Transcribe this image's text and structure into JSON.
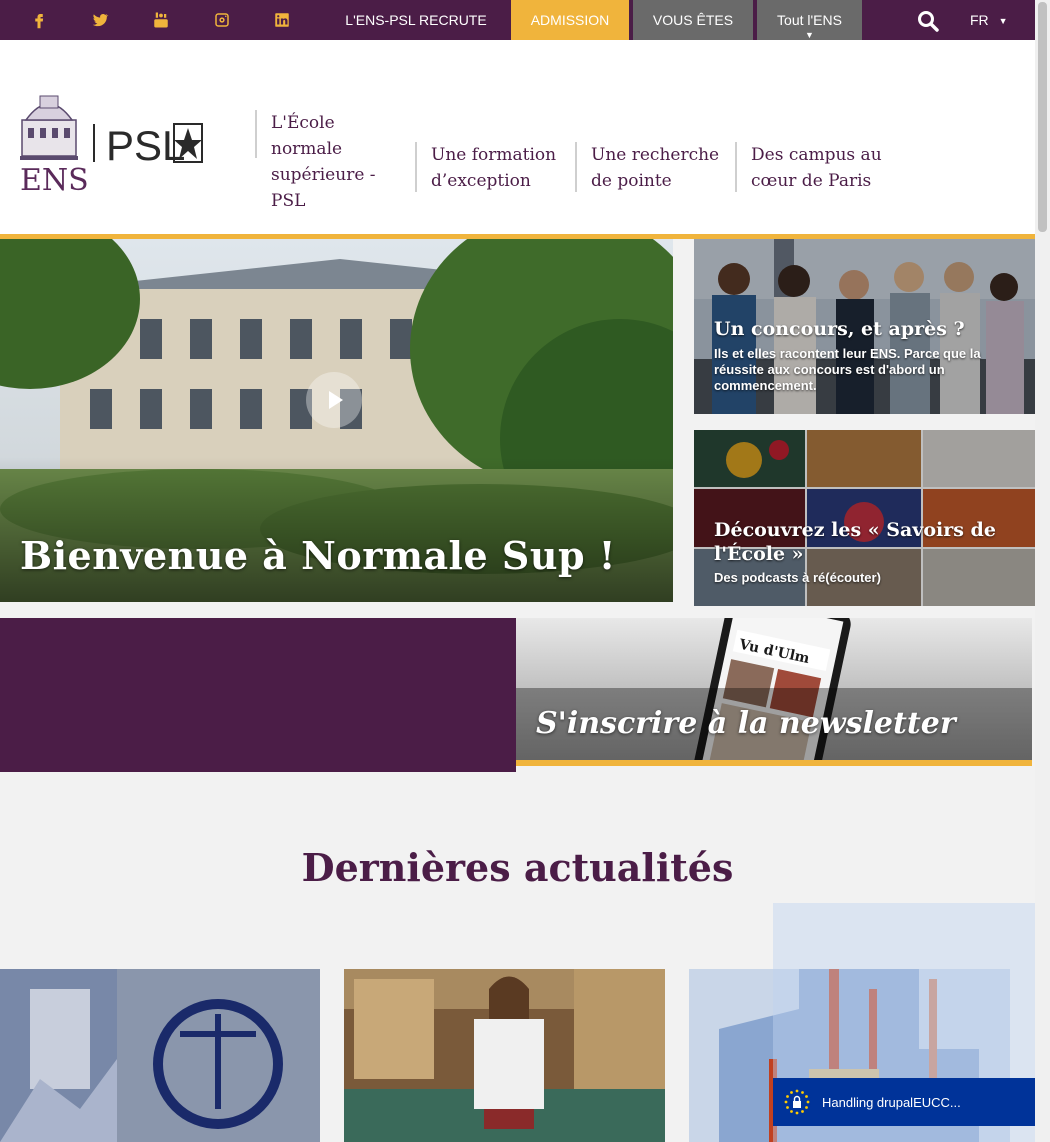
{
  "topbar": {
    "social": [
      "facebook-icon",
      "twitter-icon",
      "youtube-icon",
      "instagram-icon",
      "linkedin-icon"
    ],
    "links": {
      "recrute": "L'ENS-PSL RECRUTE",
      "admission": "ADMISSION",
      "vous_etes": "VOUS ÊTES",
      "tout_ens": "Tout l'ENS"
    },
    "tout_ens_arrow": "▼",
    "lang": "FR",
    "lang_caret": "▼"
  },
  "header": {
    "logo_ens": "ENS",
    "logo_psl": "PSL",
    "school_name": "L'École normale supérieure - PSL",
    "nav": [
      "Une formation d’exception",
      "Une recherche de pointe",
      "Des campus au cœur de Paris"
    ]
  },
  "hero": {
    "title": "Bienvenue à Normale Sup !"
  },
  "cards": {
    "concours": {
      "title": "Un concours, et après ?",
      "subtitle": "Ils et elles racontent leur ENS. Parce que la réussite aux concours est d'abord un commencement."
    },
    "savoirs": {
      "title": "Découvrez les « Savoirs de l'École »",
      "subtitle": "Des podcasts à ré(écouter)"
    }
  },
  "newsletter": {
    "title": "S'inscrire à la newsletter"
  },
  "news_section": {
    "title": "Dernières actualités"
  },
  "cookie": {
    "text": "Handling drupalEUCC..."
  },
  "colors": {
    "brand_purple": "#4b1d47",
    "accent_gold": "#f0b43c",
    "eu_blue": "#003399"
  }
}
